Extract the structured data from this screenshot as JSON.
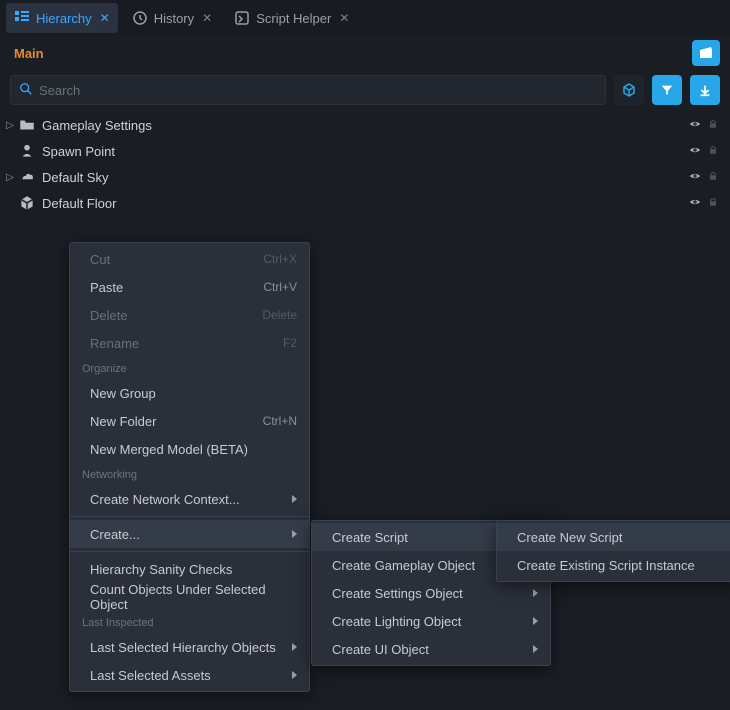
{
  "tabs": [
    {
      "label": "Hierarchy",
      "active": true
    },
    {
      "label": "History",
      "active": false
    },
    {
      "label": "Script Helper",
      "active": false
    }
  ],
  "scene": {
    "name": "Main"
  },
  "search": {
    "placeholder": "Search"
  },
  "tree": [
    {
      "label": "Gameplay Settings",
      "caret": "▷",
      "icon": "folder"
    },
    {
      "label": "Spawn Point",
      "caret": "",
      "icon": "spawn"
    },
    {
      "label": "Default Sky",
      "caret": "▷",
      "icon": "sky"
    },
    {
      "label": "Default Floor",
      "caret": "",
      "icon": "cube"
    }
  ],
  "contextMenu": {
    "main": [
      {
        "type": "item",
        "label": "Cut",
        "shortcut": "Ctrl+X",
        "disabled": true
      },
      {
        "type": "item",
        "label": "Paste",
        "shortcut": "Ctrl+V",
        "disabled": false
      },
      {
        "type": "item",
        "label": "Delete",
        "shortcut": "Delete",
        "disabled": true
      },
      {
        "type": "item",
        "label": "Rename",
        "shortcut": "F2",
        "disabled": true
      },
      {
        "type": "header",
        "label": "Organize"
      },
      {
        "type": "item",
        "label": "New Group"
      },
      {
        "type": "item",
        "label": "New Folder",
        "shortcut": "Ctrl+N"
      },
      {
        "type": "item",
        "label": "New Merged Model (BETA)"
      },
      {
        "type": "header",
        "label": "Networking"
      },
      {
        "type": "item",
        "label": "Create Network Context...",
        "sub": true
      },
      {
        "type": "sep"
      },
      {
        "type": "item",
        "label": "Create...",
        "sub": true,
        "highlight": true
      },
      {
        "type": "sep"
      },
      {
        "type": "item",
        "label": "Hierarchy Sanity Checks"
      },
      {
        "type": "item",
        "label": "Count Objects Under Selected Object"
      },
      {
        "type": "header",
        "label": "Last Inspected"
      },
      {
        "type": "item",
        "label": "Last Selected Hierarchy Objects",
        "sub": true
      },
      {
        "type": "item",
        "label": "Last Selected Assets",
        "sub": true
      }
    ],
    "create": [
      {
        "type": "item",
        "label": "Create Script",
        "sub": true,
        "highlight": true
      },
      {
        "type": "item",
        "label": "Create Gameplay Object",
        "sub": true
      },
      {
        "type": "item",
        "label": "Create Settings Object",
        "sub": true
      },
      {
        "type": "item",
        "label": "Create Lighting Object",
        "sub": true
      },
      {
        "type": "item",
        "label": "Create UI Object",
        "sub": true
      }
    ],
    "script": [
      {
        "type": "item",
        "label": "Create New Script",
        "highlight": true
      },
      {
        "type": "item",
        "label": "Create Existing Script Instance"
      }
    ]
  },
  "colors": {
    "accent": "#27a7e8",
    "orange": "#e68a2e"
  }
}
